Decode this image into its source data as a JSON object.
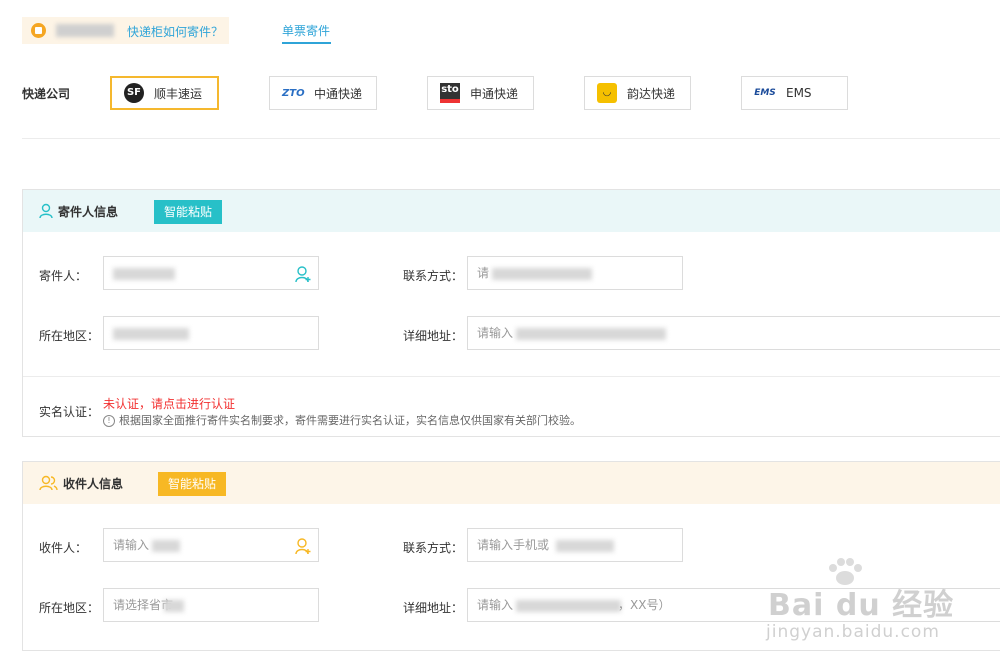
{
  "top": {
    "location_link": "快递柜如何寄件？",
    "tab_single": "单票寄件"
  },
  "company": {
    "label": "快递公司",
    "items": [
      {
        "name": "顺丰速运",
        "logo": "SF",
        "selected": true
      },
      {
        "name": "中通快递",
        "logo": "ZTO"
      },
      {
        "name": "申通快递",
        "logo": "sto"
      },
      {
        "name": "韵达快递",
        "logo": "◡"
      },
      {
        "name": "EMS",
        "logo": "EMS"
      }
    ]
  },
  "sender": {
    "title": "寄件人信息",
    "paste_label": "智能粘贴",
    "name_label": "寄件人：",
    "contact_label": "联系方式：",
    "contact_placeholder": "请",
    "region_label": "所在地区：",
    "address_label": "详细地址：",
    "address_placeholder": "请输入",
    "verify_label": "实名认证：",
    "verify_status": "未认证，请点击进行认证",
    "verify_note": "根据国家全面推行寄件实名制要求，寄件需要进行实名认证，实名信息仅供国家有关部门校验。",
    "head_color": "#eaf7f8",
    "paste_color": "#27c0c8"
  },
  "receiver": {
    "title": "收件人信息",
    "paste_label": "智能粘贴",
    "name_label": "收件人：",
    "name_placeholder": "请输入",
    "contact_label": "联系方式：",
    "contact_placeholder": "请输入手机或",
    "region_label": "所在地区：",
    "region_placeholder": "请选择省市",
    "address_label": "详细地址：",
    "address_placeholder": "请输入",
    "address_suffix": "，XX号）",
    "head_color": "#fdf5e8",
    "paste_color": "#f7b824"
  },
  "watermark": {
    "brand": "Bai du 经验",
    "url": "jingyan.baidu.com"
  }
}
